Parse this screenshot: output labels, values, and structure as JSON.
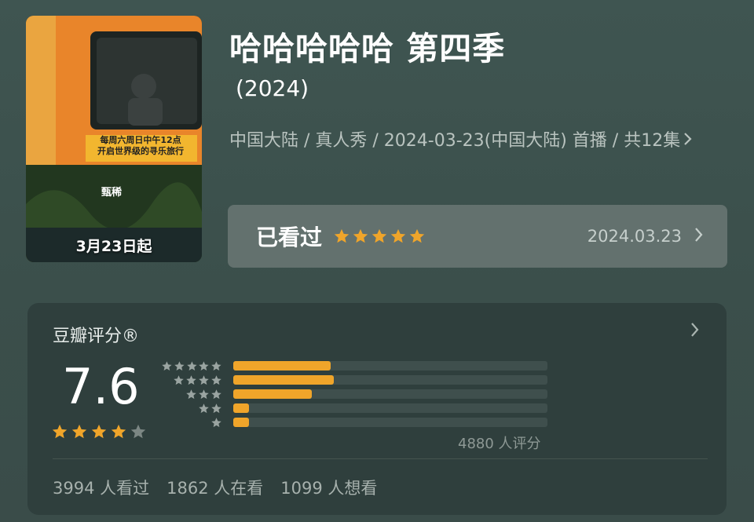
{
  "poster": {
    "caption": "3月23日起",
    "banner_line1": "每周六周日中午12点",
    "banner_line2": "开启世界级的寻乐旅行",
    "logo_text": "甄稀"
  },
  "show": {
    "title": "哈哈哈哈哈 第四季",
    "year": "(2024)",
    "meta": "中国大陆 / 真人秀 / 2024-03-23(中国大陆) 首播 / 共12集"
  },
  "watched": {
    "label": "已看过",
    "stars": 5,
    "date": "2024.03.23"
  },
  "rating": {
    "heading": "豆瓣评分®",
    "score": "7.6",
    "stars": 4,
    "distribution_fraction": [
      0.31,
      0.32,
      0.25,
      0.05,
      0.05
    ],
    "count_text": "4880 人评分",
    "stats": [
      "3994 人看过",
      "1862 人在看",
      "1099 人想看"
    ]
  },
  "colors": {
    "accent": "#f0a52a",
    "star_empty": "#7c8784",
    "card": "#2f3f3d",
    "bar_track": "#3f4f4d"
  }
}
